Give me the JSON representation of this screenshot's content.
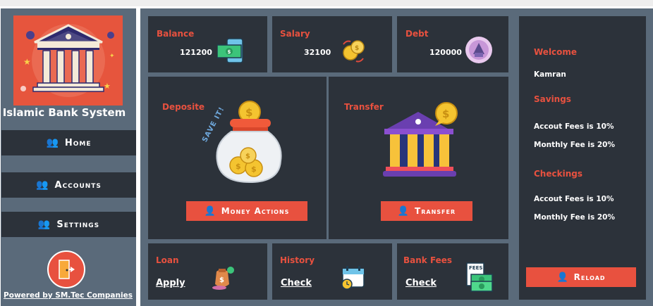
{
  "sidebar": {
    "title": "Islamic Bank System",
    "nav": [
      {
        "label": "Home",
        "icon": "users-icon"
      },
      {
        "label": "Accounts",
        "icon": "users-icon"
      },
      {
        "label": "Settings",
        "icon": "users-icon"
      }
    ],
    "powered_by": "Powered by SM.Tec Companies"
  },
  "stats": {
    "balance": {
      "label": "Balance",
      "value": "121200"
    },
    "salary": {
      "label": "Salary",
      "value": "32100"
    },
    "debt": {
      "label": "Debt",
      "value": "120000"
    }
  },
  "deposit": {
    "label": "Deposite",
    "jar_text": "SAVE IT!",
    "button": "Money Actions"
  },
  "transfer": {
    "label": "Transfer",
    "button": "Transfer"
  },
  "loan": {
    "label": "Loan",
    "link": "Apply"
  },
  "history": {
    "label": "History",
    "link": "Check"
  },
  "bank_fees": {
    "label": "Bank Fees",
    "link": "Check",
    "icon_text": "FEES"
  },
  "right_panel": {
    "welcome_label": "Welcome",
    "user_name": "Kamran",
    "savings_label": "Savings",
    "savings_account_fee": "Accout Fees is 10%",
    "savings_monthly_fee": "Monthly Fee is 20%",
    "checkings_label": "Checkings",
    "checkings_account_fee": "Accout Fees is 10%",
    "checkings_monthly_fee": "Monthly Fee is 20%",
    "reload_button": "Reload"
  },
  "colors": {
    "accent": "#e8513f",
    "panel": "#2c323a",
    "frame": "#5a6a7a",
    "logo_bg": "#e6553d"
  }
}
